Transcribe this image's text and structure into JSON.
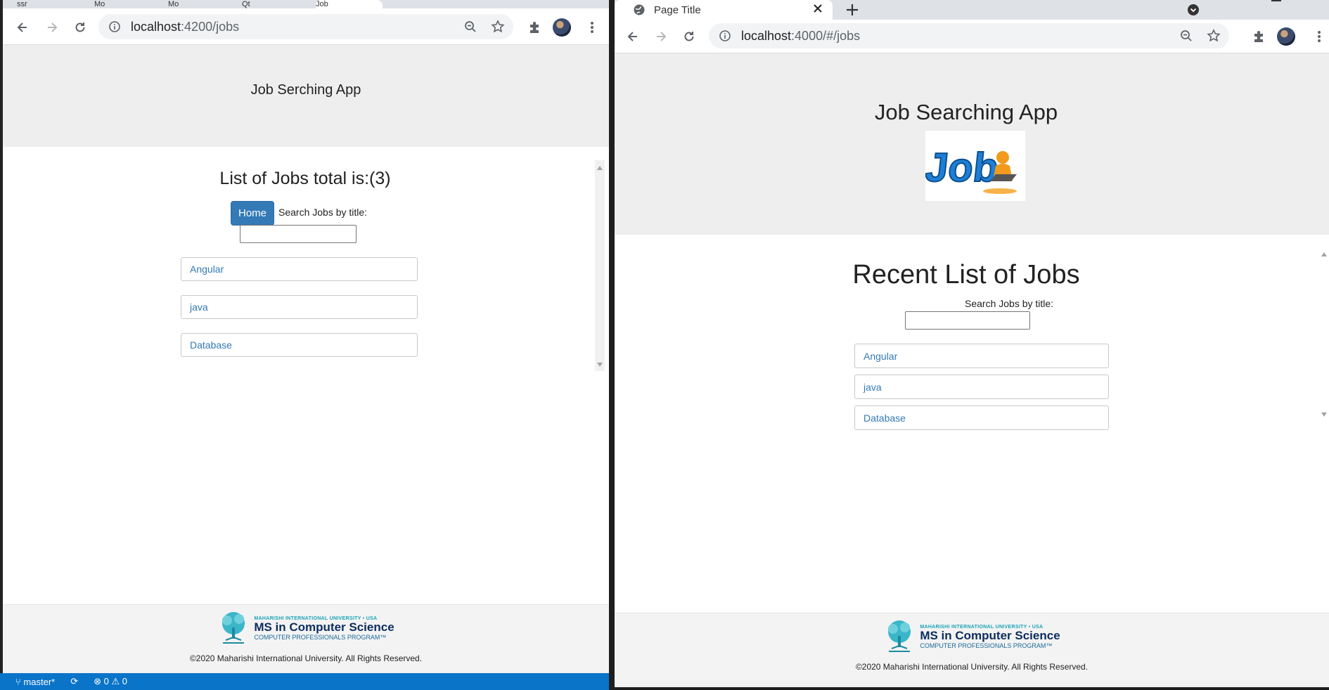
{
  "left_window": {
    "tabs": [
      {
        "label": "ssr"
      },
      {
        "label": "Mo"
      },
      {
        "label": "Mo"
      },
      {
        "label": "Qt"
      },
      {
        "label": "Job"
      }
    ],
    "url_host": "localhost",
    "url_rest": ":4200/jobs",
    "app_title": "Job Serching App",
    "list_heading": "List of Jobs total is:(3)",
    "home_button": "Home",
    "search_label": "Search Jobs by title:",
    "search_value": "",
    "jobs": [
      "Angular",
      "java",
      "Database"
    ],
    "footer": {
      "university": "MAHARISHI INTERNATIONAL UNIVERSITY • USA",
      "program": "MS in Computer Science",
      "subprogram": "COMPUTER PROFESSIONALS PROGRAM™",
      "copyright": "©2020 Maharishi International University. All Rights Reserved."
    }
  },
  "right_window": {
    "tab_title": "Page Title",
    "url_host": "localhost",
    "url_rest": ":4000/#/jobs",
    "app_title": "Job Searching App",
    "list_heading": "Recent List of Jobs",
    "search_label": "Search Jobs by title:",
    "search_value": "",
    "jobs": [
      "Angular",
      "java",
      "Database"
    ],
    "footer": {
      "university": "MAHARISHI INTERNATIONAL UNIVERSITY • USA",
      "program": "MS in Computer Science",
      "subprogram": "COMPUTER PROFESSIONALS PROGRAM™",
      "copyright": "©2020 Maharishi International University. All Rights Reserved."
    }
  },
  "statusbar": {
    "branch": "master*",
    "problems": "⊗ 0 ⚠ 0"
  },
  "colors": {
    "link": "#337ab7",
    "button": "#337ab7",
    "jumbotron": "#eeeeee",
    "statusbar": "#0a74c9"
  },
  "icons": [
    "back-icon",
    "forward-icon",
    "reload-icon",
    "info-icon",
    "zoom-icon",
    "star-icon",
    "puzzle-icon",
    "menu-icon",
    "close-icon",
    "new-tab-icon",
    "globe-icon",
    "tree-logo-icon",
    "jobs-image"
  ]
}
